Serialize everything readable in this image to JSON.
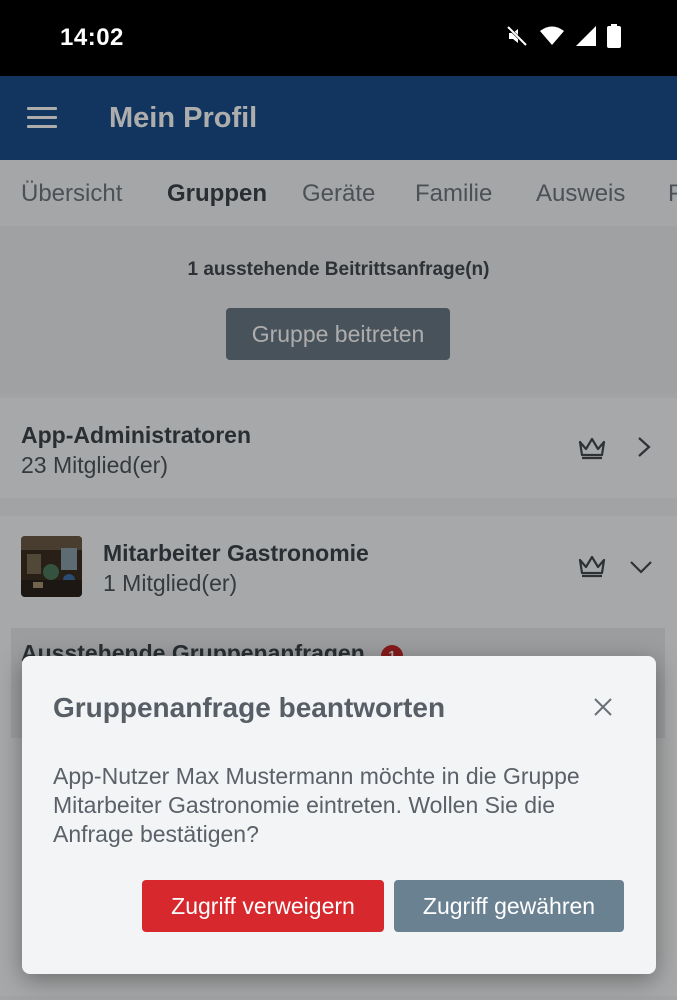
{
  "status_bar": {
    "time": "14:02",
    "icons": [
      "mute-icon",
      "wifi-icon",
      "signal-icon",
      "battery-icon"
    ]
  },
  "app_bar": {
    "title": "Mein Profil",
    "menu_icon": "hamburger-icon"
  },
  "tabs": [
    {
      "label": "Übersicht",
      "active": false
    },
    {
      "label": "Gruppen",
      "active": true
    },
    {
      "label": "Geräte",
      "active": false
    },
    {
      "label": "Familie",
      "active": false
    },
    {
      "label": "Ausweis",
      "active": false
    },
    {
      "label": "P",
      "active": false
    }
  ],
  "pending": {
    "text": "1 ausstehende Beitrittsanfrage(n)",
    "join_button": "Gruppe beitreten"
  },
  "groups": [
    {
      "name": "App-Administratoren",
      "members": "23 Mitglied(er)",
      "icons": [
        "crown-icon",
        "chevron-right-icon"
      ]
    },
    {
      "name": "Mitarbeiter Gastronomie",
      "members": "1 Mitglied(er)",
      "icons": [
        "crown-icon",
        "chevron-down-icon"
      ]
    }
  ],
  "pending_section": {
    "label": "Ausstehende Gruppenanfragen",
    "badge": "1"
  },
  "dialog": {
    "title": "Gruppenanfrage beantworten",
    "message": "App-Nutzer Max Mustermann möchte in die Gruppe Mitarbeiter Gastronomie eintreten. Wollen Sie die Anfrage bestätigen?",
    "deny_label": "Zugriff verweigern",
    "grant_label": "Zugriff gewähren"
  },
  "colors": {
    "app_bar": "#1a4f8b",
    "deny": "#d6282d",
    "grant": "#6a8192",
    "badge": "#c62828"
  }
}
